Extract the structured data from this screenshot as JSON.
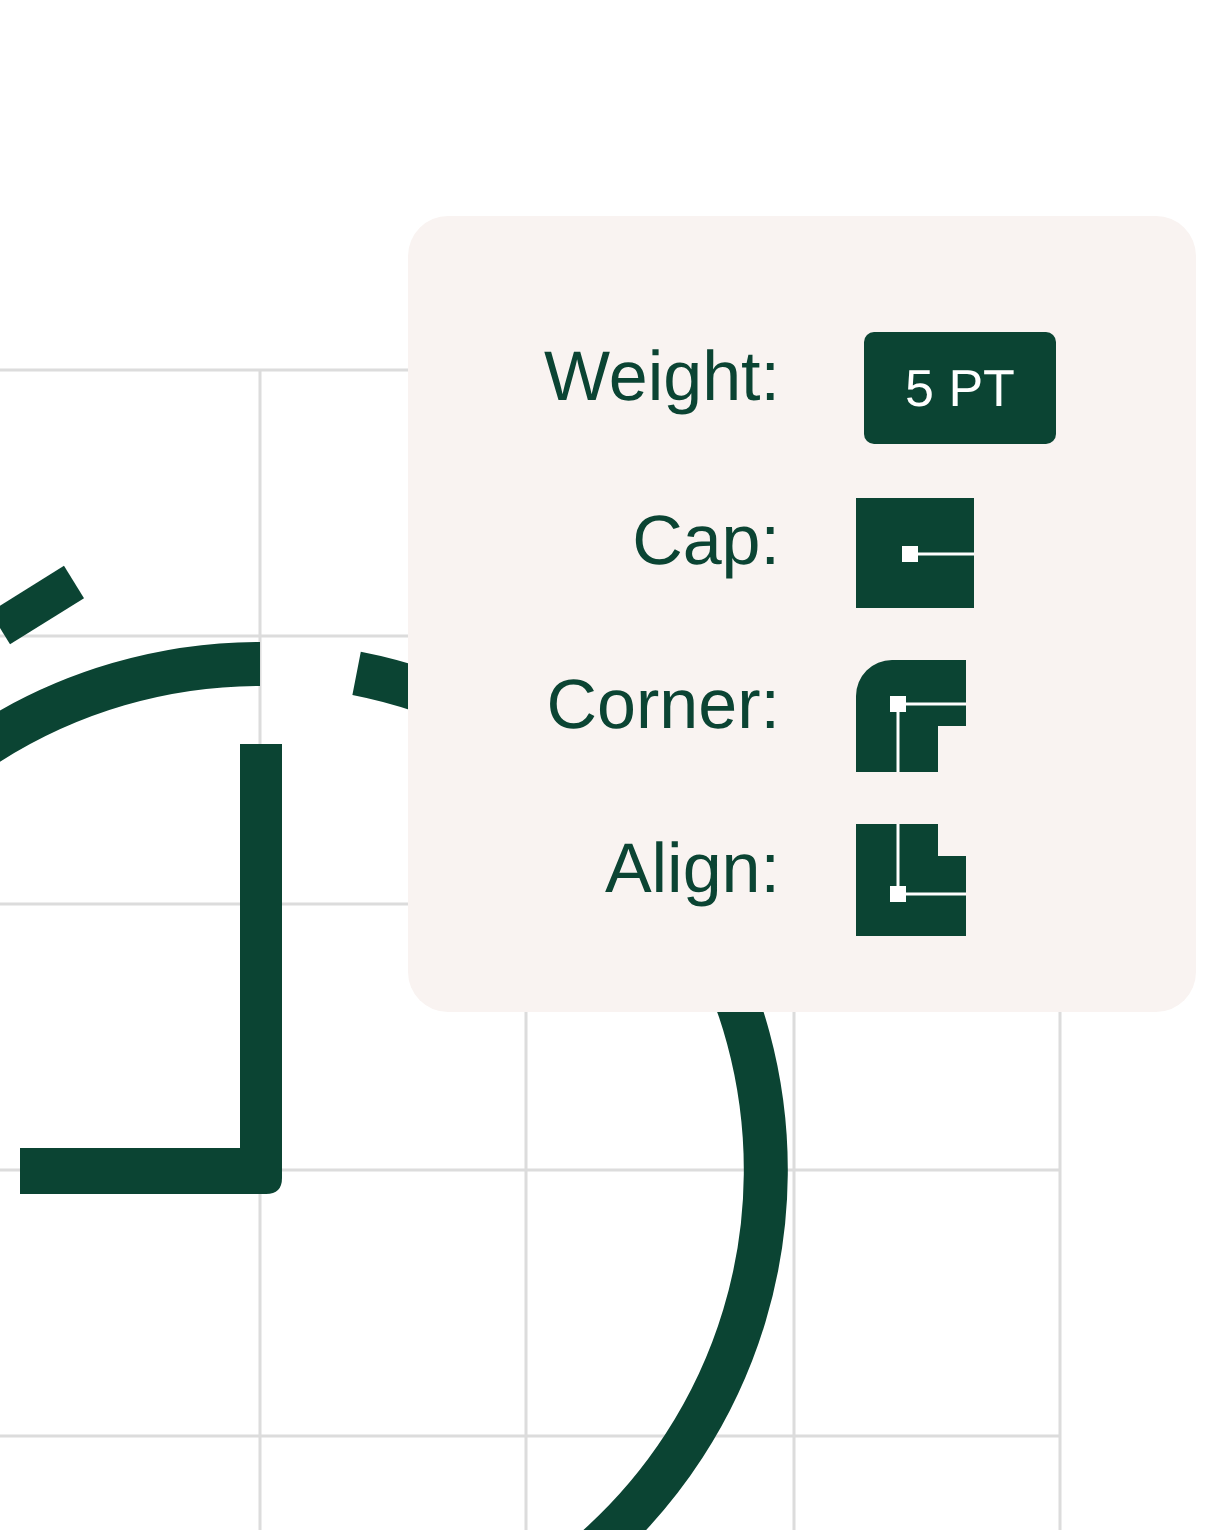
{
  "panel": {
    "rows": [
      {
        "kind": "value",
        "label": "Weight:",
        "value": "5 PT"
      },
      {
        "kind": "cap",
        "label": "Cap:"
      },
      {
        "kind": "corner",
        "label": "Corner:"
      },
      {
        "kind": "align",
        "label": "Align:"
      }
    ]
  }
}
